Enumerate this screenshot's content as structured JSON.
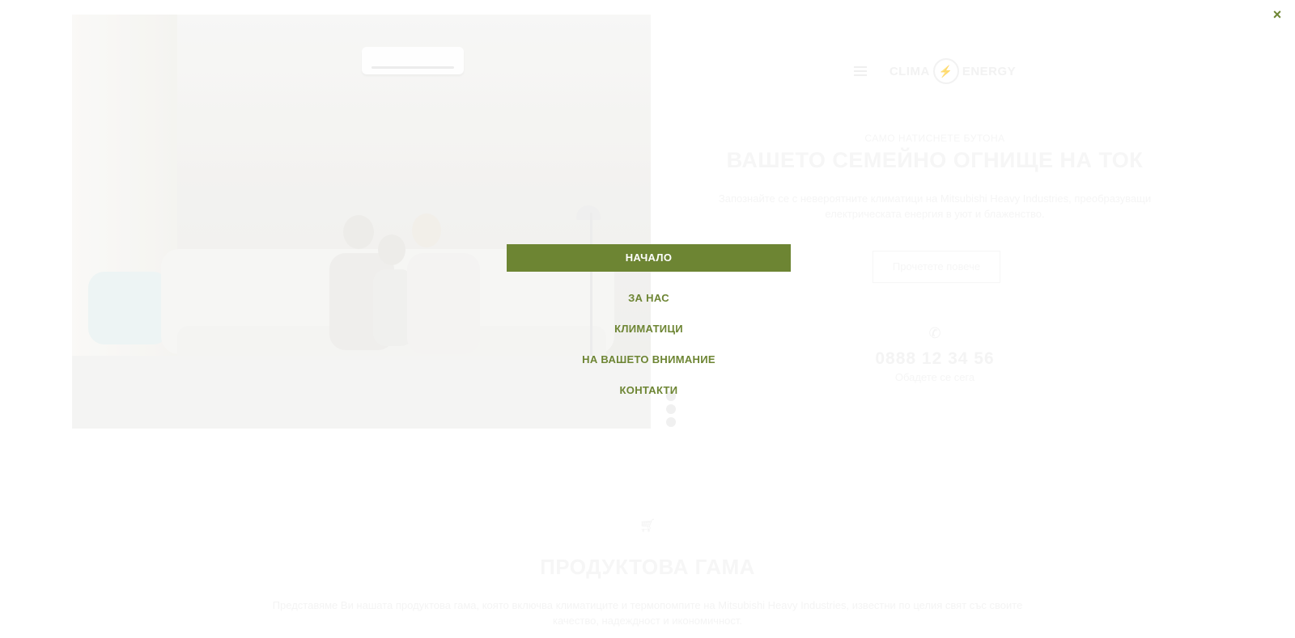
{
  "hero": {
    "logo": {
      "left": "CLIMA",
      "right": "ENERGY",
      "mark": "⚡"
    },
    "eyebrow": "САМО НАТИСНЕТЕ БУТОНА",
    "title": "ВАШЕТО СЕМЕЙНО ОГНИЩЕ НА ТОК",
    "text": "Запознайте се с невероятните климатици на Mitsubishi Heavy Industries, преобразуващи електрическата енергия в уют и блаженство.",
    "read_more": "Прочетете повече",
    "phone_icon": "phone-icon",
    "phone": "0888 12 34 56",
    "call_now": "Обадете се сега"
  },
  "products": {
    "icon": "cart-icon",
    "title": "ПРОДУКТОВА ГАМА",
    "text": "Представяме Ви нашата продуктова гама, която включва климатиците и термопомпите на Mitsubishi Heavy Industries, известни по целия свят със своите качество, надеждност и икономичност."
  },
  "menu": {
    "close_symbol": "×",
    "items": [
      {
        "label": "НАЧАЛО",
        "active": true
      },
      {
        "label": "ЗА НАС",
        "active": false
      },
      {
        "label": "КЛИМАТИЦИ",
        "active": false
      },
      {
        "label": "НА ВАШЕТО ВНИМАНИЕ",
        "active": false
      },
      {
        "label": "КОНТАКТИ",
        "active": false
      }
    ]
  },
  "colors": {
    "accent": "#6d8533",
    "overlay": "#ffffff"
  }
}
